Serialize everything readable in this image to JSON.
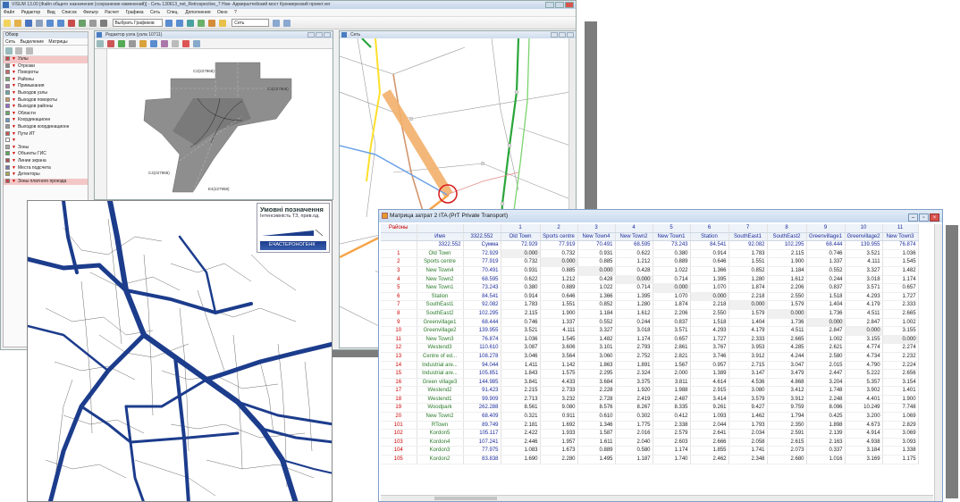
{
  "visum": {
    "title": "VISUM 13.00 [Файл общего назначения (сохранение изменений)] - Сеть 130613_net_Retrospective_7 Нов- Адмиралтейский мост Кронверкский проект.ver",
    "menu": [
      "Файл",
      "Редактор",
      "Вид",
      "Список",
      "Фильтр",
      "Расчет",
      "Графика",
      "Сеть",
      "Спец.",
      "Дополнения",
      "Окно",
      "?"
    ],
    "toolbar_select": "Выбрать Графиков",
    "toolbar_select2": "Сеть",
    "left_panel": {
      "header": "Обзор",
      "tabs": [
        "Сеть",
        "Выделение",
        "Матрицы"
      ],
      "items": [
        {
          "label": "Узлы",
          "hl": true
        },
        {
          "label": "Отрезки",
          "hl": false
        },
        {
          "label": "Повороты",
          "hl": false
        },
        {
          "label": "Районы",
          "hl": false
        },
        {
          "label": "Примыкания",
          "hl": false
        },
        {
          "label": "Выходов узлы",
          "hl": false
        },
        {
          "label": "Выходов повороты",
          "hl": false
        },
        {
          "label": "Выходов районы",
          "hl": false
        },
        {
          "label": "Области",
          "hl": false
        },
        {
          "label": "Координационн",
          "hl": false
        },
        {
          "label": "Выходов координационн",
          "hl": false
        },
        {
          "label": "Пути ИТ",
          "hl": false
        },
        {
          "label": "",
          "hl": false
        },
        {
          "label": "Зоны",
          "hl": false
        },
        {
          "label": "Объекты ГИС",
          "hl": false
        },
        {
          "label": "Линии экрана",
          "hl": false
        },
        {
          "label": "Места подсчета",
          "hl": false
        },
        {
          "label": "Детекторы",
          "hl": false
        },
        {
          "label": "Зоны платного проезда",
          "hl": true
        }
      ]
    },
    "junction_editor_title": "Редактор узла (узла 10711)",
    "junction_labels": [
      "C2(227968)",
      "C3(227968)",
      "C4(227968)",
      "E4(227968)"
    ],
    "network_title": "Сеть"
  },
  "map_legend": {
    "title": "Умовні позначення",
    "subtitle": "Інтенсивність ТЗ, прив.од.",
    "bar_label": "ЕЧАСТЕРОНОГЕНК"
  },
  "matrix": {
    "title": "Матрица затрат 2 ITA (PrT Private Transport)",
    "corner_label": "Районы",
    "name_header": "Имя",
    "total_number": "3322.552",
    "sum_row_label": "3322.552",
    "sum_row_name": "Сумма",
    "column_numbers": [
      "1",
      "2",
      "3",
      "4",
      "5",
      "6",
      "7",
      "8",
      "9",
      "10",
      "11"
    ],
    "column_names": [
      "Old Town",
      "Sports centre",
      "New Town4",
      "New Town2",
      "New Town1",
      "Station",
      "SouthEast1",
      "SouthEast2",
      "Greenvillage1",
      "Greenvillage2",
      "New Town3"
    ],
    "column_sums": [
      "72.929",
      "77.919",
      "70.491",
      "68.595",
      "73.243",
      "84.541",
      "92.082",
      "102.295",
      "68.444",
      "139.955",
      "76.874"
    ],
    "rows": [
      {
        "id": "1",
        "name": "Old Town",
        "total": "72.929",
        "vals": [
          "0.000",
          "0.732",
          "0.931",
          "0.622",
          "0.380",
          "0.914",
          "1.783",
          "2.115",
          "0.746",
          "3.521",
          "1.036"
        ]
      },
      {
        "id": "2",
        "name": "Sports centre",
        "total": "77.919",
        "vals": [
          "0.732",
          "0.000",
          "0.885",
          "1.212",
          "0.889",
          "0.646",
          "1.551",
          "1.900",
          "1.337",
          "4.111",
          "1.545"
        ]
      },
      {
        "id": "3",
        "name": "New Town4",
        "total": "70.491",
        "vals": [
          "0.931",
          "0.885",
          "0.000",
          "0.428",
          "1.022",
          "1.366",
          "0.852",
          "1.184",
          "0.552",
          "3.327",
          "1.482"
        ]
      },
      {
        "id": "4",
        "name": "New Town2",
        "total": "68.595",
        "vals": [
          "0.622",
          "1.212",
          "0.428",
          "0.000",
          "0.714",
          "1.395",
          "1.280",
          "1.612",
          "0.244",
          "3.018",
          "1.174"
        ]
      },
      {
        "id": "5",
        "name": "New Town1",
        "total": "73.243",
        "vals": [
          "0.380",
          "0.889",
          "1.022",
          "0.714",
          "0.000",
          "1.070",
          "1.874",
          "2.206",
          "0.837",
          "3.571",
          "0.657"
        ]
      },
      {
        "id": "6",
        "name": "Station",
        "total": "84.541",
        "vals": [
          "0.914",
          "0.646",
          "1.366",
          "1.395",
          "1.070",
          "0.000",
          "2.218",
          "2.550",
          "1.518",
          "4.293",
          "1.727"
        ]
      },
      {
        "id": "7",
        "name": "SouthEast1",
        "total": "92.082",
        "vals": [
          "1.783",
          "1.551",
          "0.852",
          "1.280",
          "1.874",
          "2.218",
          "0.000",
          "1.579",
          "1.404",
          "4.179",
          "2.333"
        ]
      },
      {
        "id": "8",
        "name": "SouthEast2",
        "total": "102.295",
        "vals": [
          "2.115",
          "1.900",
          "1.184",
          "1.612",
          "2.206",
          "2.550",
          "1.579",
          "0.000",
          "1.736",
          "4.511",
          "2.665"
        ]
      },
      {
        "id": "9",
        "name": "Greenvillage1",
        "total": "68.444",
        "vals": [
          "0.746",
          "1.337",
          "0.552",
          "0.244",
          "0.837",
          "1.518",
          "1.404",
          "1.736",
          "0.000",
          "2.847",
          "1.002"
        ]
      },
      {
        "id": "10",
        "name": "Greenvillage2",
        "total": "139.955",
        "vals": [
          "3.521",
          "4.111",
          "3.327",
          "3.018",
          "3.571",
          "4.293",
          "4.179",
          "4.511",
          "2.847",
          "0.000",
          "3.155"
        ]
      },
      {
        "id": "11",
        "name": "New Town3",
        "total": "76.874",
        "vals": [
          "1.036",
          "1.545",
          "1.482",
          "1.174",
          "0.657",
          "1.727",
          "2.333",
          "2.665",
          "1.002",
          "3.155",
          "0.000"
        ]
      },
      {
        "id": "12",
        "name": "Westend3",
        "total": "110.610",
        "vals": [
          "3.087",
          "3.606",
          "3.101",
          "2.793",
          "2.861",
          "3.767",
          "3.953",
          "4.285",
          "2.621",
          "4.774",
          "2.274"
        ]
      },
      {
        "id": "13",
        "name": "Centre of ed...",
        "total": "108.278",
        "vals": [
          "3.046",
          "3.564",
          "3.060",
          "2.752",
          "2.821",
          "3.746",
          "3.912",
          "4.244",
          "2.580",
          "4.734",
          "2.232"
        ]
      },
      {
        "id": "14",
        "name": "Industrial are...",
        "total": "94.044",
        "vals": [
          "1.411",
          "1.142",
          "1.863",
          "1.891",
          "1.567",
          "0.957",
          "2.715",
          "3.047",
          "2.015",
          "4.790",
          "2.224"
        ]
      },
      {
        "id": "15",
        "name": "Industrial are...",
        "total": "105.851",
        "vals": [
          "1.843",
          "1.575",
          "2.295",
          "2.324",
          "2.000",
          "1.389",
          "3.147",
          "3.479",
          "2.447",
          "5.222",
          "2.656"
        ]
      },
      {
        "id": "16",
        "name": "Green village3",
        "total": "144.985",
        "vals": [
          "3.841",
          "4.433",
          "3.684",
          "3.375",
          "3.811",
          "4.614",
          "4.536",
          "4.868",
          "3.204",
          "5.357",
          "3.154"
        ]
      },
      {
        "id": "17",
        "name": "Westend2",
        "total": "91.423",
        "vals": [
          "2.215",
          "2.733",
          "2.228",
          "1.920",
          "1.988",
          "2.915",
          "3.080",
          "3.412",
          "1.748",
          "3.902",
          "1.401"
        ]
      },
      {
        "id": "18",
        "name": "Westend1",
        "total": "99.909",
        "vals": [
          "2.713",
          "3.232",
          "2.728",
          "2.419",
          "2.487",
          "3.414",
          "3.579",
          "3.912",
          "2.248",
          "4.401",
          "1.900"
        ]
      },
      {
        "id": "19",
        "name": "Woodpark",
        "total": "262.288",
        "vals": [
          "8.561",
          "9.080",
          "8.576",
          "8.267",
          "8.335",
          "9.261",
          "9.427",
          "9.759",
          "8.096",
          "10.249",
          "7.748"
        ]
      },
      {
        "id": "20",
        "name": "New Town2",
        "total": "68.409",
        "vals": [
          "0.321",
          "0.911",
          "0.610",
          "0.302",
          "0.412",
          "1.093",
          "1.462",
          "1.794",
          "0.425",
          "3.200",
          "1.069"
        ]
      },
      {
        "id": "101",
        "name": "RTown",
        "total": "89.749",
        "vals": [
          "2.181",
          "1.692",
          "1.346",
          "1.775",
          "2.338",
          "2.044",
          "1.793",
          "2.350",
          "1.898",
          "4.673",
          "2.829"
        ]
      },
      {
        "id": "102",
        "name": "Kordon5",
        "total": "105.117",
        "vals": [
          "2.422",
          "1.933",
          "1.587",
          "2.016",
          "2.579",
          "2.641",
          "2.034",
          "2.591",
          "2.139",
          "4.914",
          "3.069"
        ]
      },
      {
        "id": "103",
        "name": "Kordon4",
        "total": "107.241",
        "vals": [
          "2.446",
          "1.957",
          "1.611",
          "2.040",
          "2.603",
          "2.666",
          "2.058",
          "2.615",
          "2.163",
          "4.938",
          "3.093"
        ]
      },
      {
        "id": "104",
        "name": "Kordon3",
        "total": "77.975",
        "vals": [
          "1.083",
          "1.673",
          "0.889",
          "0.580",
          "1.174",
          "1.855",
          "1.741",
          "2.073",
          "0.337",
          "3.184",
          "1.338"
        ]
      },
      {
        "id": "105",
        "name": "Kordon2",
        "total": "83.838",
        "vals": [
          "1.690",
          "2.280",
          "1.495",
          "1.187",
          "1.740",
          "2.462",
          "2.348",
          "2.680",
          "1.016",
          "3.169",
          "1.175"
        ]
      }
    ]
  }
}
